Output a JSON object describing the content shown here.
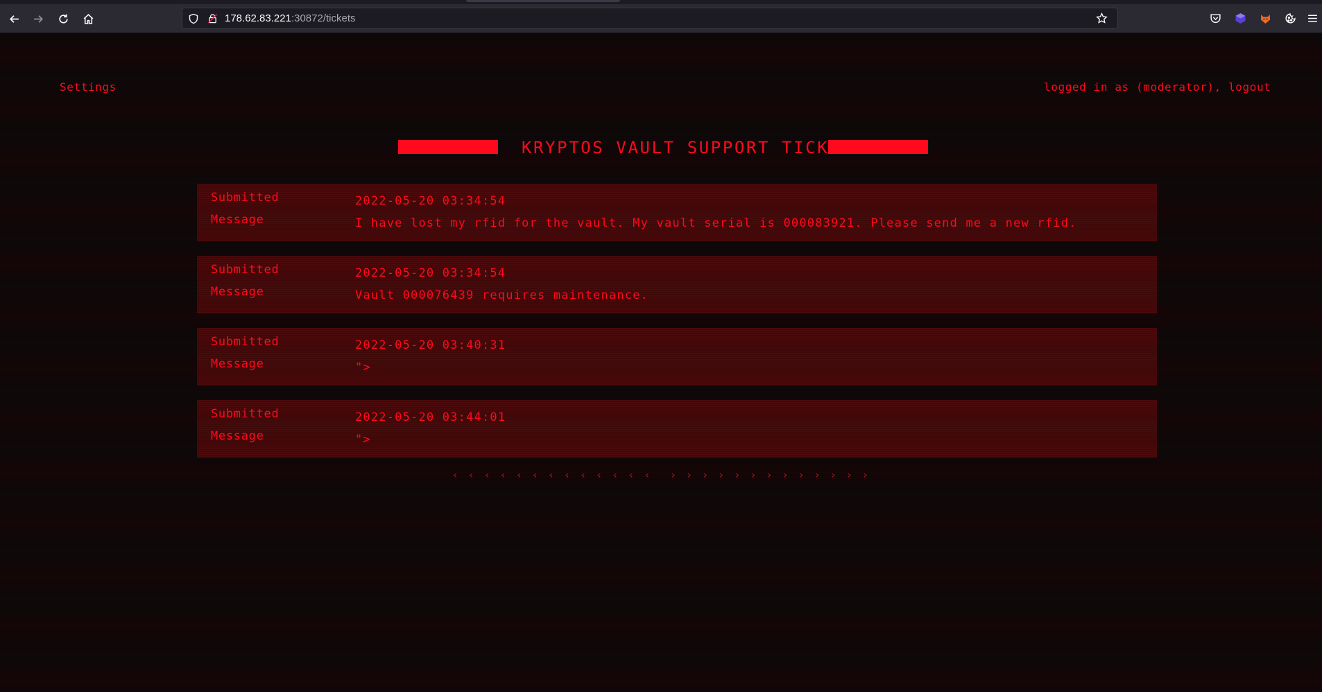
{
  "browser": {
    "url_host": "178.62.83.221",
    "url_path": ":30872/tickets",
    "icons": {
      "back": "back-arrow-icon",
      "forward": "forward-arrow-icon",
      "reload": "reload-icon",
      "home": "home-icon",
      "tracking": "shield-icon",
      "lock": "lock-icon",
      "bookmark": "star-icon",
      "pocket": "pocket-icon",
      "ext1": "extension-cube-icon",
      "ext2": "extension-fox-icon",
      "ext3": "cookie-icon",
      "menu": "hamburger-menu-icon"
    }
  },
  "header": {
    "settings_label": "Settings",
    "session_label": "logged in as (moderator), logout"
  },
  "title": "KRYPTOS VAULT SUPPORT TICKETS",
  "ticket_labels": {
    "submitted": "Submitted",
    "message": "Message"
  },
  "tickets": [
    {
      "submitted": "2022-05-20 03:34:54",
      "message": "I have lost my rfid for the vault. My vault serial is 000083921. Please send me a new rfid."
    },
    {
      "submitted": "2022-05-20 03:34:54",
      "message": "Vault 000076439 requires maintenance."
    },
    {
      "submitted": "2022-05-20 03:40:31",
      "message": "\">"
    },
    {
      "submitted": "2022-05-20 03:44:01",
      "message": "\">"
    }
  ],
  "pagination": {
    "prev": "‹ ‹ ‹ ‹ ‹ ‹ ‹ ‹ ‹ ‹ ‹ ‹ ‹",
    "next": "› › › › › › › › › › › › ›"
  },
  "colors": {
    "accent": "#ff0a1d",
    "ticket_bg": "#400809",
    "page_bg": "#0e0708"
  }
}
